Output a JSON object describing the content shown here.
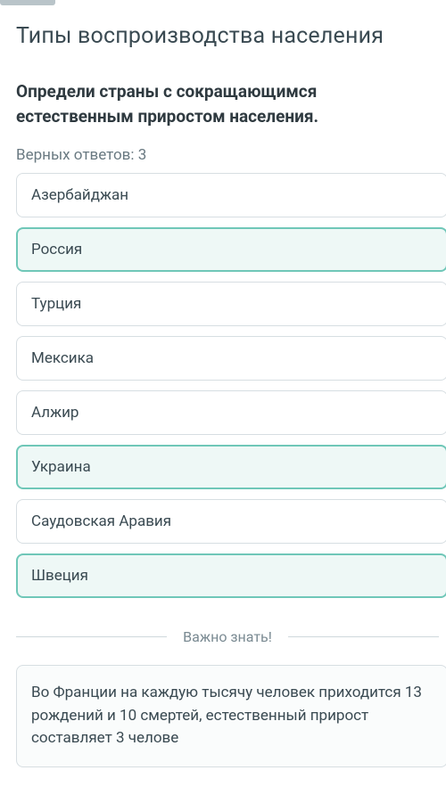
{
  "page_title": "Типы воспроизводства населения",
  "question_text": "Определи страны с сокращающимся естественным приростом населения.",
  "correct_count_label": "Верных ответов: 3",
  "options": [
    {
      "label": "Азербайджан",
      "selected": false
    },
    {
      "label": "Россия",
      "selected": true
    },
    {
      "label": "Турция",
      "selected": false
    },
    {
      "label": "Мексика",
      "selected": false
    },
    {
      "label": "Алжир",
      "selected": false
    },
    {
      "label": "Украина",
      "selected": true
    },
    {
      "label": "Саудовская Аравия",
      "selected": false
    },
    {
      "label": "Швеция",
      "selected": true
    }
  ],
  "divider_label": "Важно знать!",
  "info_text": "Во Франции на каждую тысячу человек приходится 13 рождений и 10 смертей, естественный прирост составляет 3 челове"
}
